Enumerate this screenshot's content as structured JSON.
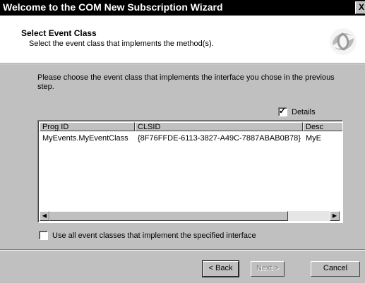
{
  "window": {
    "title": "Welcome to the COM New Subscription Wizard",
    "close_label": "X"
  },
  "header": {
    "title": "Select Event Class",
    "subtitle": "Select the event class that implements the method(s).",
    "logo_icon": "com-wizard-swirl-icon"
  },
  "body": {
    "intro": "Please choose the event class that implements the interface you chose in the previous step.",
    "details_checkbox": {
      "label": "Details",
      "checked": true
    }
  },
  "list": {
    "columns": [
      "Prog ID",
      "CLSID",
      "Desc"
    ],
    "rows": [
      {
        "progid": "MyEvents.MyEventClass",
        "clsid": "{8F76FFDE-6113-3827-A49C-7887ABAB0B78}",
        "desc": "MyE"
      }
    ]
  },
  "use_all": {
    "label": "Use all event classes that implement the specified interface",
    "checked": false
  },
  "buttons": {
    "back": "< Back",
    "next": "Next >",
    "cancel": "Cancel"
  }
}
